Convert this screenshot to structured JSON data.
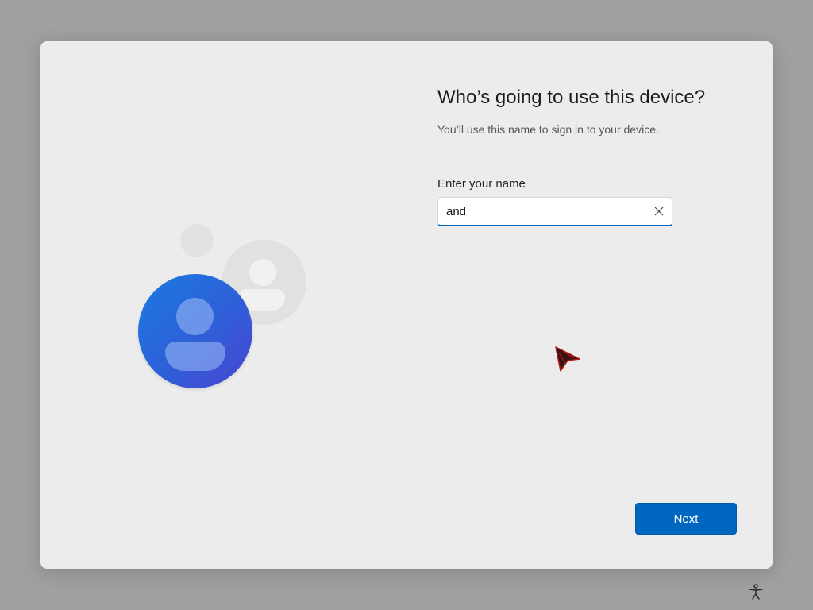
{
  "dialog": {
    "title": "Who’s going to use this device?",
    "subtitle": "You’ll use this name to sign in to your device.",
    "name_field": {
      "label": "Enter your name",
      "value": "and",
      "clear_icon": "close-icon"
    },
    "next_label": "Next"
  },
  "illustration": {
    "icons": [
      "user-avatar-icon",
      "user-avatar-icon"
    ]
  },
  "taskbar": {
    "accessibility_icon": "accessibility-icon"
  },
  "colors": {
    "accent": "#0067c0",
    "dialog_bg": "#ececec",
    "backdrop": "#a0a0a0"
  }
}
